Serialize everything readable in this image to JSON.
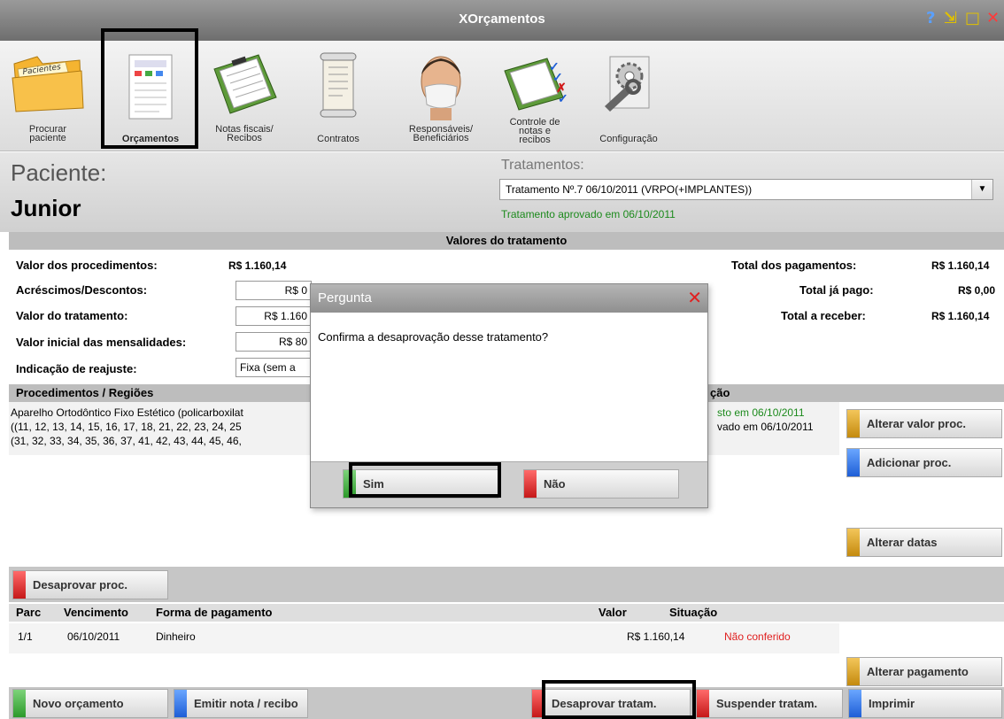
{
  "window": {
    "title": "XOrçamentos",
    "help": "?",
    "minimize": "⇲",
    "maximize": "□",
    "close": "✕"
  },
  "toolbar": {
    "items": [
      {
        "label1": "Procurar",
        "label2": "paciente",
        "icon_text": "Pacientes"
      },
      {
        "label1": "",
        "label2": "Orçamentos"
      },
      {
        "label1": "Notas fiscais/",
        "label2": "Recibos"
      },
      {
        "label1": "",
        "label2": "Contratos"
      },
      {
        "label1": "Responsáveis/",
        "label2": "Beneficiários"
      },
      {
        "label1": "Controle de",
        "label2": "notas e",
        "label3": "recibos"
      },
      {
        "label1": "",
        "label2": "Configuração"
      }
    ]
  },
  "patient": {
    "label": "Paciente:",
    "name": "Junior"
  },
  "treatments": {
    "label": "Tratamentos:",
    "selected": "Tratamento Nº.7 06/10/2011 (VRPO(+IMPLANTES))",
    "status": "Tratamento aprovado em 06/10/2011"
  },
  "values": {
    "section_title": "Valores do tratamento",
    "proc_value_label": "Valor dos procedimentos:",
    "proc_value": "R$ 1.160,14",
    "adjust_label": "Acréscimos/Descontos:",
    "adjust_value": "R$ 0",
    "treatment_label": "Valor do tratamento:",
    "treatment_value": "R$ 1.160",
    "initial_label": "Valor inicial das mensalidades:",
    "initial_value": "R$ 80",
    "readjust_label": "Indicação de reajuste:",
    "readjust_value": "Fixa (sem a",
    "total_payments_label": "Total dos pagamentos:",
    "total_payments": "R$ 1.160,14",
    "total_paid_label": "Total já pago:",
    "total_paid": "R$ 0,00",
    "total_receive_label": "Total a receber:",
    "total_receive": "R$ 1.160,14"
  },
  "procedures": {
    "header": "Procedimentos / Regiões",
    "header_right": "ção",
    "line1": "Aparelho Ortodôntico Fixo Estético (policarboxilat",
    "line2": "((11, 12, 13, 14, 15, 16, 17, 18, 21, 22, 23, 24, 25",
    "line3": "(31, 32, 33, 34, 35, 36, 37, 41, 42, 43, 44, 45, 46,",
    "status1": "sto em 06/10/2011",
    "status2": "vado em 06/10/2011"
  },
  "side_buttons": {
    "change_value": "Alterar valor proc.",
    "add_proc": "Adicionar proc.",
    "change_dates": "Alterar datas",
    "change_payment": "Alterar pagamento"
  },
  "disapprove_proc": "Desaprovar proc.",
  "payments": {
    "headers": {
      "parc": "Parc",
      "due": "Vencimento",
      "form": "Forma de pagamento",
      "value": "Valor",
      "status": "Situação"
    },
    "rows": [
      {
        "parc": "1/1",
        "due": "06/10/2011",
        "form": "Dinheiro",
        "value": "R$ 1.160,14",
        "status": "Não conferido"
      }
    ]
  },
  "bottom_buttons": {
    "new_budget": "Novo orçamento",
    "emit_note": "Emitir nota / recibo",
    "disapprove_treat": "Desaprovar tratam.",
    "suspend_treat": "Suspender tratam.",
    "print": "Imprimir"
  },
  "dialog": {
    "title": "Pergunta",
    "message": "Confirma a desaprovação desse tratamento?",
    "yes": "Sim",
    "no": "Não",
    "close": "✕"
  }
}
